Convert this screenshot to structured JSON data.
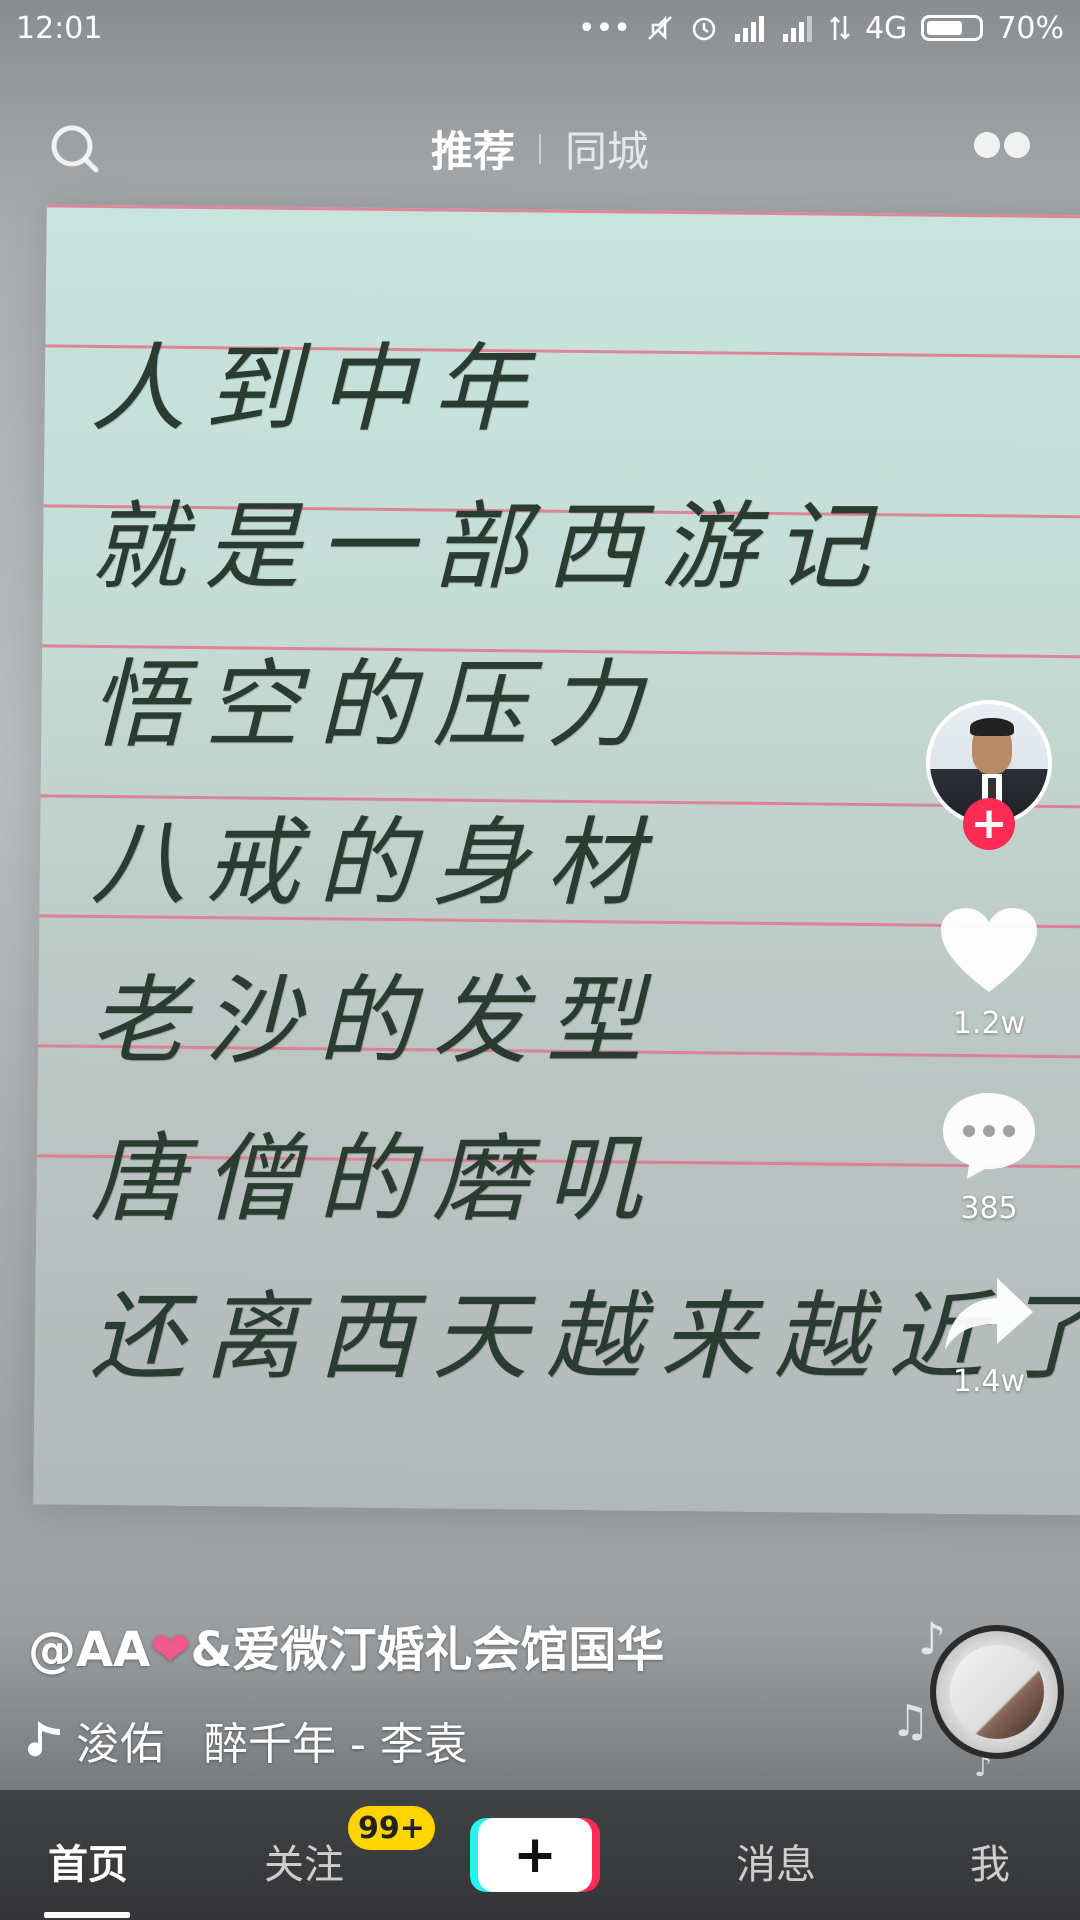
{
  "status_bar": {
    "time": "12:01",
    "signal_text": "4G",
    "battery_percent": "70%",
    "battery_level": 0.7
  },
  "top_nav": {
    "tabs": [
      {
        "label": "推荐",
        "active": true
      },
      {
        "label": "同城",
        "active": false
      }
    ]
  },
  "video": {
    "poem_lines": [
      "人到中年",
      "就是一部西游记",
      "悟空的压力",
      "八戒的身材",
      "老沙的发型",
      "唐僧的磨叽",
      "还离西天越来越近了!"
    ]
  },
  "rail": {
    "like_count": "1.2w",
    "comment_count": "385",
    "share_count": "1.4w",
    "follow_symbol": "+"
  },
  "info": {
    "author_prefix": "@AA",
    "author_heart": "❤",
    "author_suffix": "&爱微汀婚礼会馆国华",
    "music_user": "浚佑",
    "music_title": "醉千年 - 李袁"
  },
  "tabbar": {
    "home": "首页",
    "follow": "关注",
    "follow_badge": "99+",
    "add": "+",
    "messages": "消息",
    "me": "我"
  },
  "colors": {
    "accent_red": "#fe2c55",
    "accent_cyan": "#25f4ee",
    "badge_yellow": "#ffd500"
  }
}
